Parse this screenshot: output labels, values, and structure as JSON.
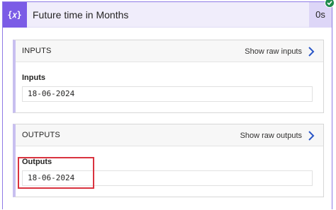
{
  "header": {
    "icon_glyph": "{𝑥}",
    "icon_name": "expression-icon",
    "title": "Future time in Months",
    "duration": "0s",
    "status": "succeeded"
  },
  "inputs": {
    "section_title": "INPUTS",
    "show_raw_label": "Show raw inputs",
    "field_label": "Inputs",
    "field_value": "18-06-2024"
  },
  "outputs": {
    "section_title": "OUTPUTS",
    "show_raw_label": "Show raw outputs",
    "field_label": "Outputs",
    "field_value": "18-06-2024"
  },
  "colors": {
    "accent": "#7b5ce6",
    "header_bg": "#f0edfb",
    "success": "#1f8a4c",
    "link_chevron": "#2b57c7",
    "highlight": "#d9333f"
  }
}
